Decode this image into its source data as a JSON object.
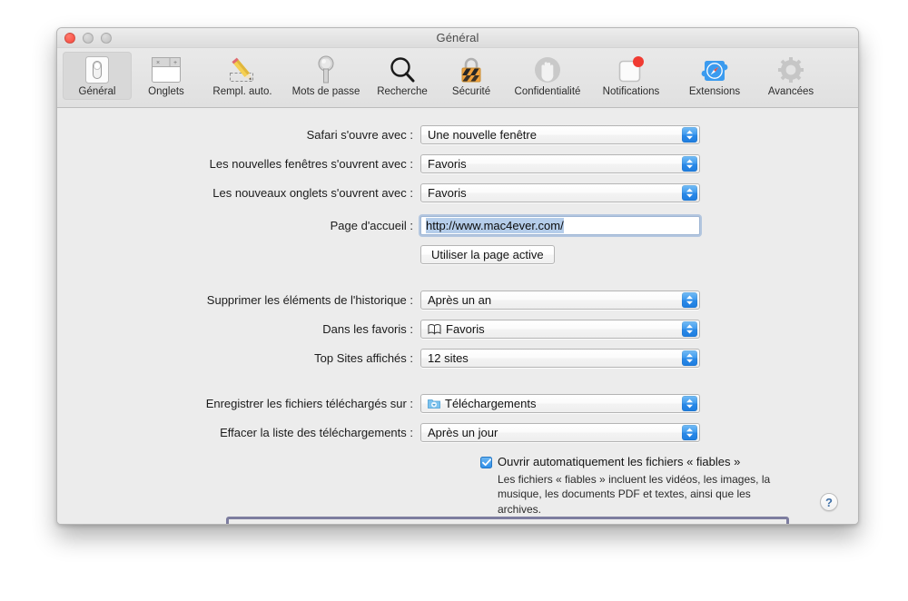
{
  "window": {
    "title": "Général",
    "traffic_lights": [
      "close",
      "minimize",
      "maximize"
    ]
  },
  "toolbar": {
    "items": [
      {
        "label": "Général",
        "icon": "general-switch-icon",
        "selected": true
      },
      {
        "label": "Onglets",
        "icon": "tabs-icon",
        "selected": false
      },
      {
        "label": "Rempl. auto.",
        "icon": "autofill-pencil-icon",
        "selected": false
      },
      {
        "label": "Mots de passe",
        "icon": "key-icon",
        "selected": false
      },
      {
        "label": "Recherche",
        "icon": "magnifier-icon",
        "selected": false
      },
      {
        "label": "Sécurité",
        "icon": "padlock-icon",
        "selected": false
      },
      {
        "label": "Confidentialité",
        "icon": "hand-icon",
        "selected": false
      },
      {
        "label": "Notifications",
        "icon": "notification-badge-icon",
        "selected": false
      },
      {
        "label": "Extensions",
        "icon": "extensions-puzzle-icon",
        "selected": false
      },
      {
        "label": "Avancées",
        "icon": "gear-icon",
        "selected": false
      }
    ]
  },
  "form": {
    "safari_opens": {
      "label": "Safari s'ouvre avec :",
      "value": "Une nouvelle fenêtre"
    },
    "new_windows": {
      "label": "Les nouvelles fenêtres s'ouvrent avec :",
      "value": "Favoris"
    },
    "new_tabs": {
      "label": "Les nouveaux onglets s'ouvrent avec :",
      "value": "Favoris"
    },
    "homepage": {
      "label": "Page d'accueil :",
      "value": "http://www.mac4ever.com/",
      "selected": true
    },
    "use_current_page": {
      "label": "Utiliser la page active"
    },
    "remove_history": {
      "label": "Supprimer les éléments de l'historique :",
      "value": "Après un an"
    },
    "favorites": {
      "label": "Dans les favoris :",
      "value": "Favoris",
      "icon": "book-icon"
    },
    "top_sites": {
      "label": "Top Sites affichés :",
      "value": "12 sites"
    },
    "download_location": {
      "label": "Enregistrer les fichiers téléchargés sur :",
      "value": "Téléchargements",
      "icon": "downloads-folder-icon"
    },
    "clear_downloads": {
      "label": "Effacer la liste des téléchargements :",
      "value": "Après un jour",
      "highlighted": true,
      "highlight_color": "#7d7d9f"
    },
    "auto_open": {
      "label": "Ouvrir automatiquement les fichiers « fiables »",
      "checked": true,
      "description": "Les fichiers « fiables » incluent les vidéos, les images, la musique, les documents PDF et textes, ainsi que les archives."
    }
  },
  "help": {
    "label": "?"
  }
}
